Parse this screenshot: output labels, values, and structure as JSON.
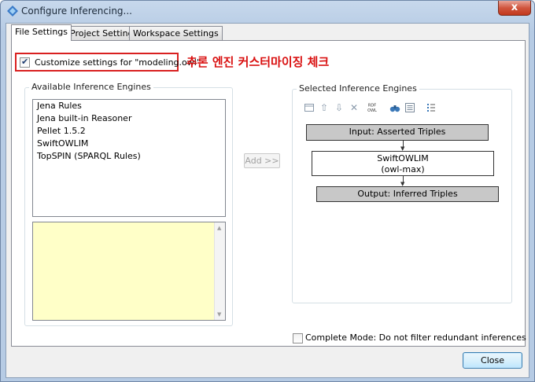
{
  "window": {
    "title": "Configure Inferencing...",
    "close_glyph": "x"
  },
  "tabs": [
    {
      "label": "File Settings",
      "active": true
    },
    {
      "label": "Project Settings",
      "active": false
    },
    {
      "label": "Workspace Settings",
      "active": false
    }
  ],
  "customize": {
    "label": "Customize settings for \"modeling.owl\"",
    "checked": true,
    "annotation": "추론 엔진 커스터마이징 체크"
  },
  "available": {
    "group_label": "Available Inference Engines",
    "items": [
      "Jena Rules",
      "Jena built-in Reasoner",
      "Pellet 1.5.2",
      "SwiftOWLIM",
      "TopSPIN (SPARQL Rules)"
    ]
  },
  "add_button": {
    "label": "Add >>",
    "enabled": false
  },
  "selected": {
    "group_label": "Selected Inference Engines",
    "toolbar_icons": [
      "frame-icon",
      "arrow-up-icon",
      "arrow-down-icon",
      "remove-icon",
      "rdf-owl-icon",
      "binoculars-icon",
      "properties-icon",
      "list-icon"
    ],
    "rdf_icon_text": [
      "RDF",
      "OWL"
    ],
    "pipeline": {
      "input": "Input: Asserted Triples",
      "engine_name": "SwiftOWLIM",
      "engine_mode": "(owl-max)",
      "output": "Output: Inferred Triples"
    }
  },
  "complete_mode": {
    "label": "Complete Mode: Do not filter redundant inferences",
    "checked": false
  },
  "close_button": {
    "label": "Close"
  },
  "colors": {
    "annotation": "#d91010",
    "highlight_box": "#d92020",
    "description_bg": "#ffffc8",
    "flow_grey": "#c8c8c8"
  }
}
